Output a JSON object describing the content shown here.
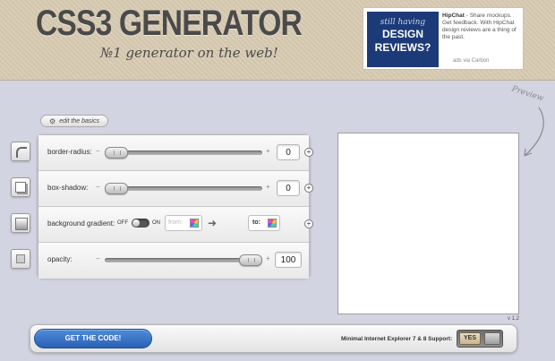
{
  "header": {
    "title": "CSS3 GENERATOR",
    "tagline": "№1 generator on the web!"
  },
  "ad": {
    "image_line1": "still having",
    "image_line2": "DESIGN",
    "image_line3": "REVIEWS?",
    "brand": "HipChat",
    "text": "- Share mockups. Get feedback. With HipChat design reviews are a thing of the past.",
    "via": "ads via Carbon"
  },
  "edit_basics": {
    "label": "edit the basics",
    "icon": "gear-icon"
  },
  "controls": {
    "border_radius": {
      "label": "border-radius:",
      "value": "0",
      "slider_fraction": 0.0
    },
    "box_shadow": {
      "label": "box-shadow:",
      "value": "0",
      "slider_fraction": 0.0
    },
    "background_gradient": {
      "label": "background gradient:",
      "off_label": "OFF",
      "on_label": "ON",
      "from_placeholder": "from:",
      "to_label": "to:"
    },
    "opacity": {
      "label": "opacity:",
      "value": "100",
      "slider_fraction": 1.0
    }
  },
  "preview": {
    "label": "Preview",
    "version": "v 1.2"
  },
  "bottom": {
    "get_code_label": "GET THE CODE!",
    "ie_support_label": "Minimal Internet Explorer 7 & 8 Support:",
    "ie_toggle_value": "YES"
  },
  "colors": {
    "header_bg": "#d9cbb3",
    "page_bg": "#d3d4e2",
    "accent_blue": "#2a62b5"
  }
}
